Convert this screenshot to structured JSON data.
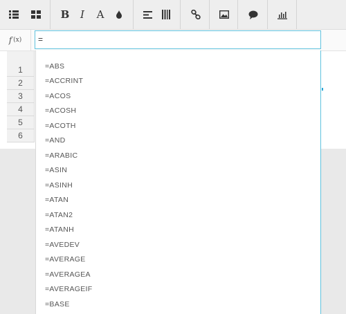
{
  "toolbar": {
    "icons": [
      "list-icon",
      "grid-icon",
      "bold-icon",
      "italic-icon",
      "font-icon",
      "fill-color-icon",
      "align-left-icon",
      "columns-icon",
      "link-icon",
      "image-icon",
      "comment-icon",
      "chart-icon"
    ],
    "bold_label": "B",
    "italic_label": "I",
    "font_label": "A"
  },
  "formula_bar": {
    "fx_label": "f",
    "fx_paren": "(x)",
    "value": "="
  },
  "rows": [
    "1",
    "2",
    "3",
    "4",
    "5",
    "6"
  ],
  "suggestions": [
    "=ABS",
    "=ACCRINT",
    "=ACOS",
    "=ACOSH",
    "=ACOTH",
    "=AND",
    "=ARABIC",
    "=ASIN",
    "=ASINH",
    "=ATAN",
    "=ATAN2",
    "=ATANH",
    "=AVEDEV",
    "=AVERAGE",
    "=AVERAGEA",
    "=AVERAGEIF",
    "=BASE"
  ]
}
